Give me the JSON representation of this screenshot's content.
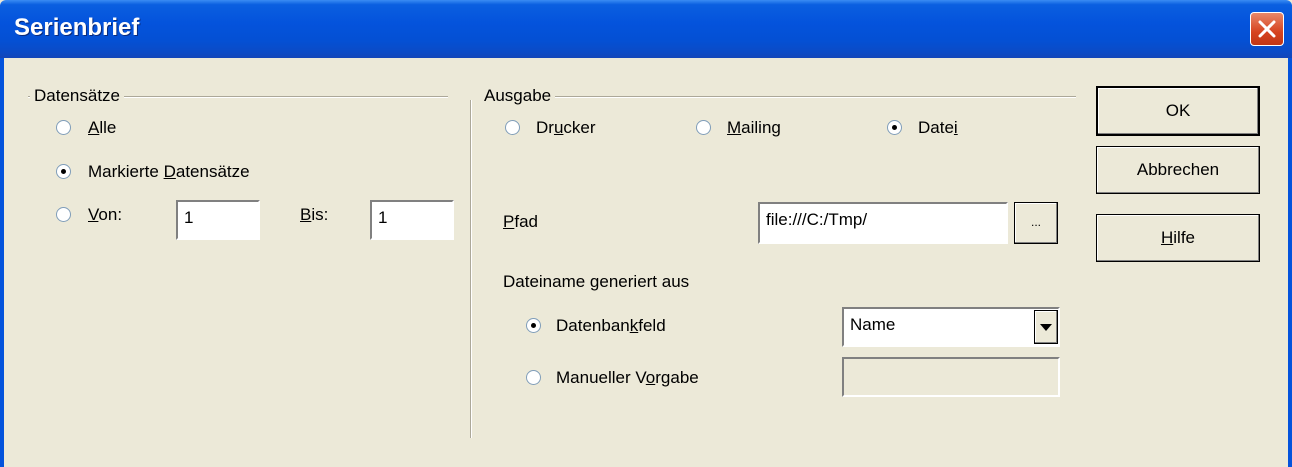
{
  "window": {
    "title": "Serienbrief"
  },
  "datensaetze": {
    "group_label": "Datensätze",
    "alle_label": "Alle",
    "markierte_label": "Markierte Datensätze",
    "von_label": "Von:",
    "von_value": "1",
    "bis_label": "Bis:",
    "bis_value": "1",
    "selected": "Markierte Datensätze"
  },
  "ausgabe": {
    "group_label": "Ausgabe",
    "drucker_label": "Drucker",
    "mailing_label": "Mailing",
    "datei_label": "Datei",
    "selected": "Datei",
    "pfad_label": "Pfad",
    "pfad_value": "file:///C:/Tmp/",
    "browse_label": "...",
    "dateiname_label": "Dateiname generiert aus",
    "datenbankfeld_label": "Datenbankfeld",
    "datenbankfeld_value": "Name",
    "manuell_label": "Manueller Vorgabe",
    "manuell_value": "",
    "dateiname_selected": "Datenbankfeld"
  },
  "buttons": {
    "ok": "OK",
    "abbrechen": "Abbrechen",
    "hilfe": "Hilfe"
  },
  "icons": {
    "close": "close-icon",
    "dropdown": "chevron-down-icon"
  }
}
